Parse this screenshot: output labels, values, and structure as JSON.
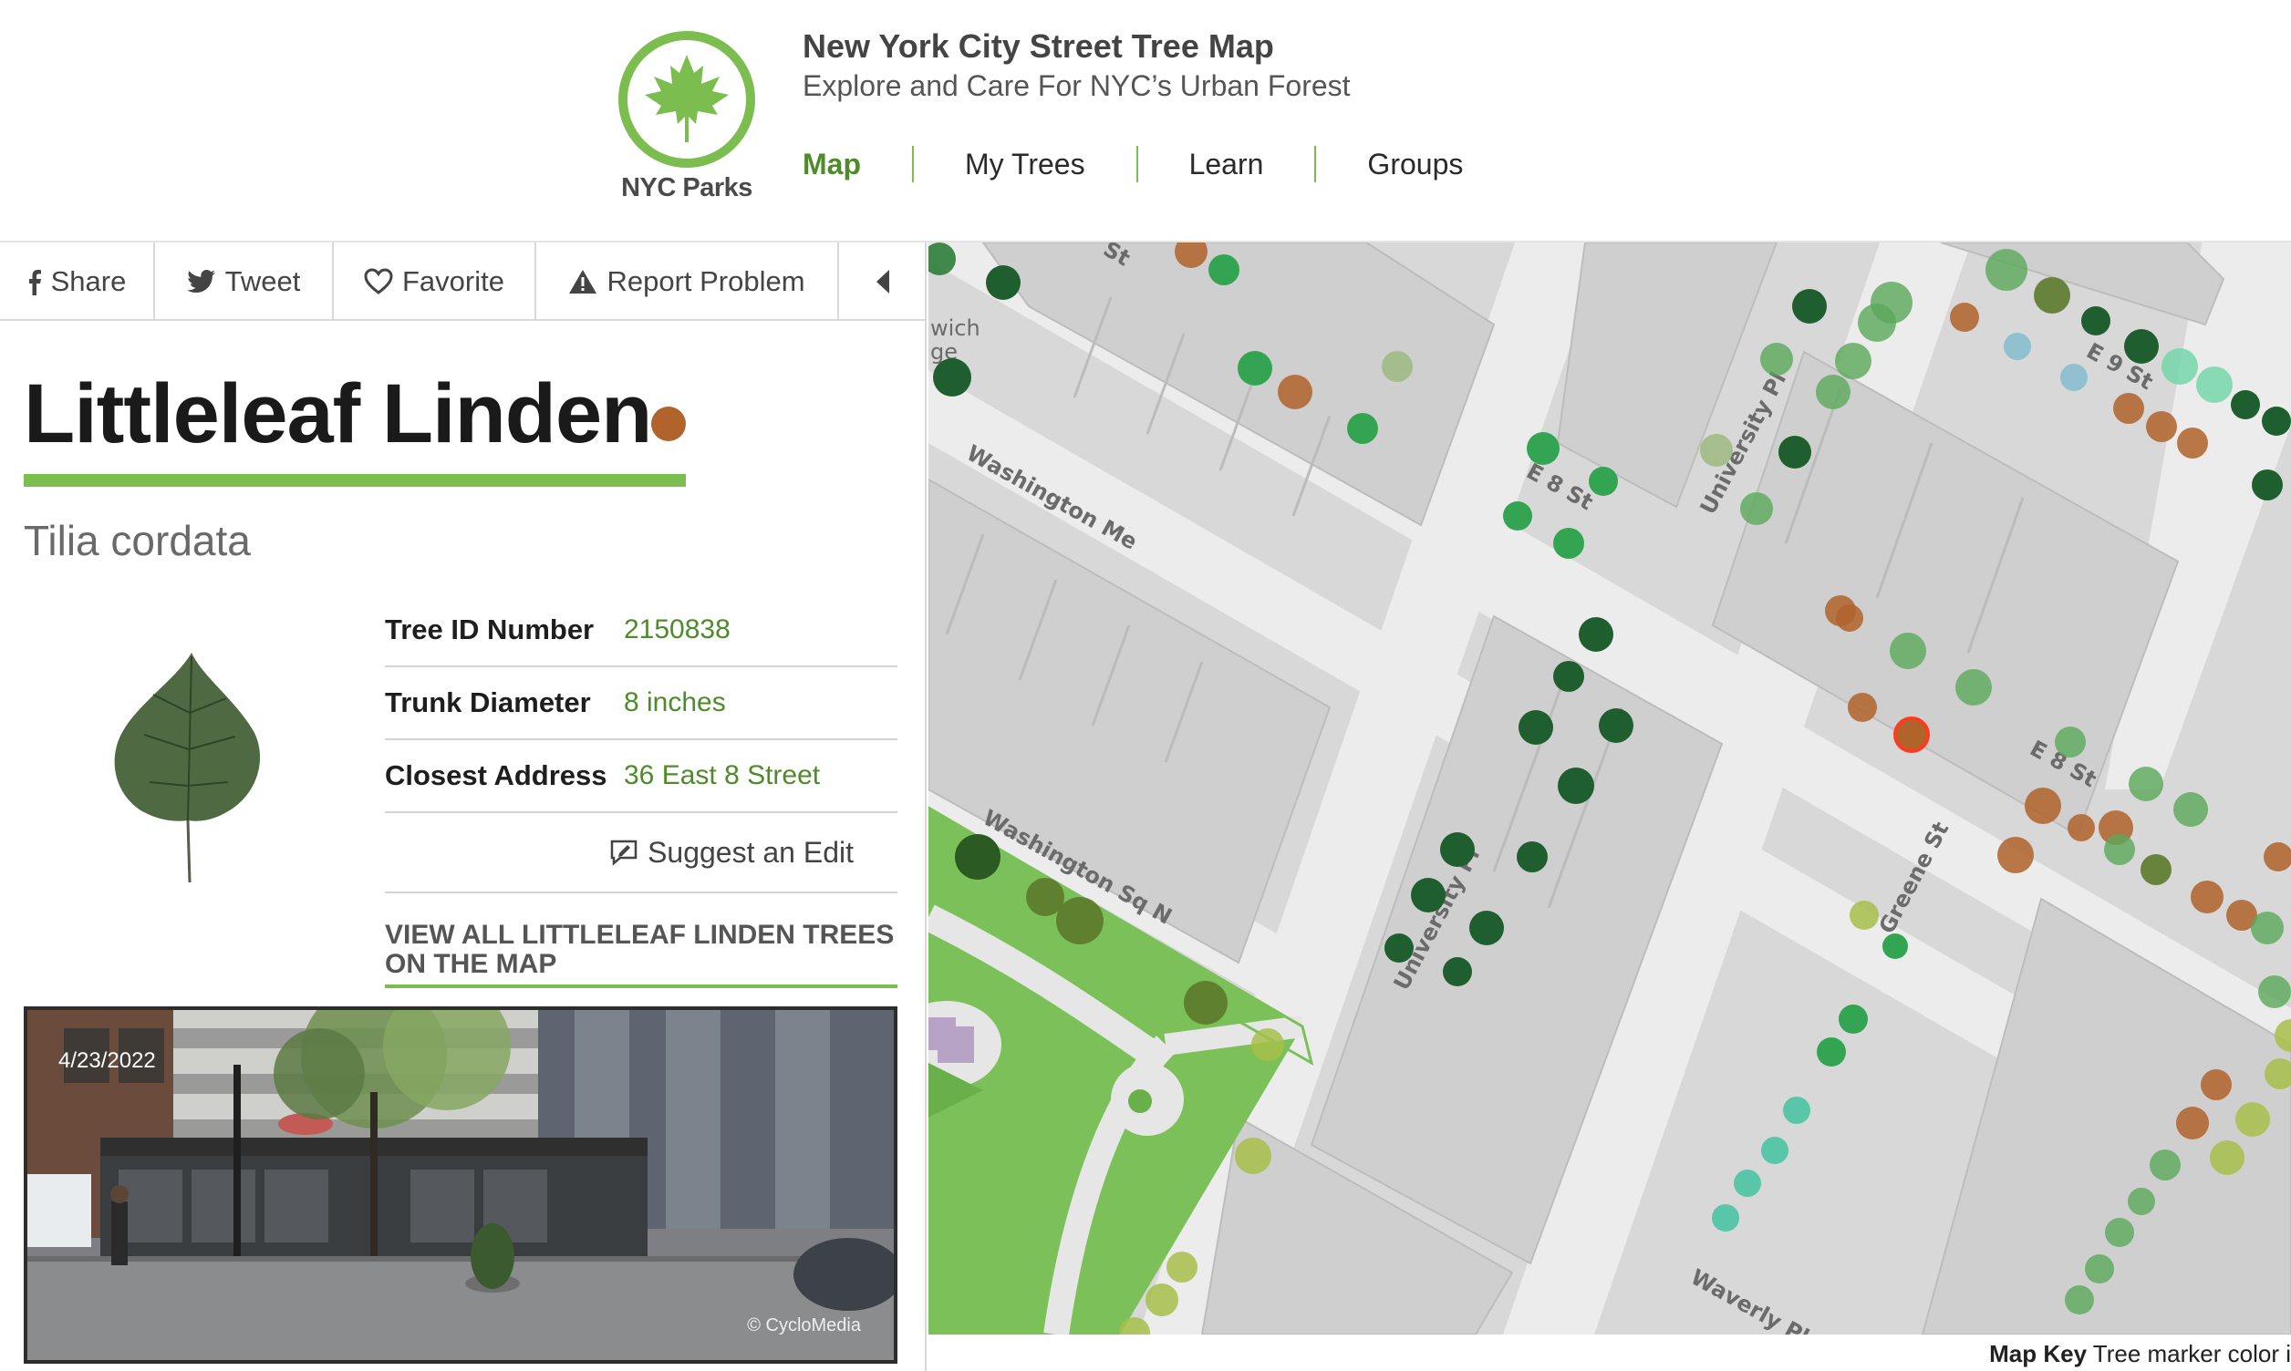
{
  "header": {
    "logo_text": "NYC Parks",
    "title": "New York City Street Tree Map",
    "subtitle": "Explore and Care For NYC’s Urban Forest",
    "nav": [
      {
        "label": "Map",
        "active": true
      },
      {
        "label": "My Trees",
        "active": false
      },
      {
        "label": "Learn",
        "active": false
      },
      {
        "label": "Groups",
        "active": false
      }
    ]
  },
  "actions": {
    "share": "Share",
    "tweet": "Tweet",
    "favorite": "Favorite",
    "report": "Report Problem"
  },
  "tree": {
    "common_name": "Littleleaf Linden",
    "scientific_name": "Tilia cordata",
    "marker_color": "#b0632b",
    "details": [
      {
        "label": "Tree ID Number",
        "value": "2150838"
      },
      {
        "label": "Trunk Diameter",
        "value": "8 inches"
      },
      {
        "label": "Closest Address",
        "value": "36 East 8 Street"
      }
    ],
    "suggest_edit": "Suggest an Edit",
    "view_all": "VIEW ALL LITTLELEAF LINDEN TREES ON THE MAP"
  },
  "streetview": {
    "date": "4/23/2022",
    "credit": "© CycloMedia"
  },
  "map": {
    "street_labels": [
      "St",
      "wich",
      "ge",
      "Washington Me",
      "E 8 St",
      "University Pl",
      "E 9 St",
      "E 8 St",
      "Greene St",
      "Washington Sq N",
      "University Pl",
      "Waverly Pl"
    ],
    "key_label": "Map Key",
    "key_text": "Tree marker color i"
  },
  "colors": {
    "accent_green": "#7bbd4f",
    "link_green": "#4f8a2b"
  }
}
